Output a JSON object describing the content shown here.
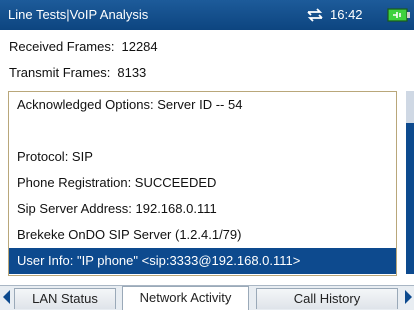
{
  "header": {
    "title": "Line Tests|VoIP Analysis",
    "time": "16:42",
    "network_icon": "network-transfer-icon",
    "battery_icon": "battery-plugged-icon"
  },
  "stats": {
    "received_label": "Received Frames:",
    "received_value": "12284",
    "transmit_label": "Transmit Frames:",
    "transmit_value": "8133"
  },
  "details": {
    "rows": [
      "Acknowledged Options: Server ID -- 54",
      "",
      "Protocol: SIP",
      "Phone Registration:   SUCCEEDED",
      "Sip Server Address: 192.168.0.111",
      "Brekeke OnDO SIP Server (1.2.4.1/79)",
      "User Info: \"IP phone\" <sip:3333@192.168.0.111>"
    ],
    "selected_index": 6
  },
  "tabs": [
    {
      "label": "LAN Status"
    },
    {
      "label": "Network Activity"
    },
    {
      "label": "Call History"
    }
  ],
  "active_tab": 1,
  "colors": {
    "header_blue": "#0d4580",
    "selection_blue": "#0d4a8e",
    "panel_border": "#b9a77a",
    "battery_green": "#3fd23f"
  }
}
